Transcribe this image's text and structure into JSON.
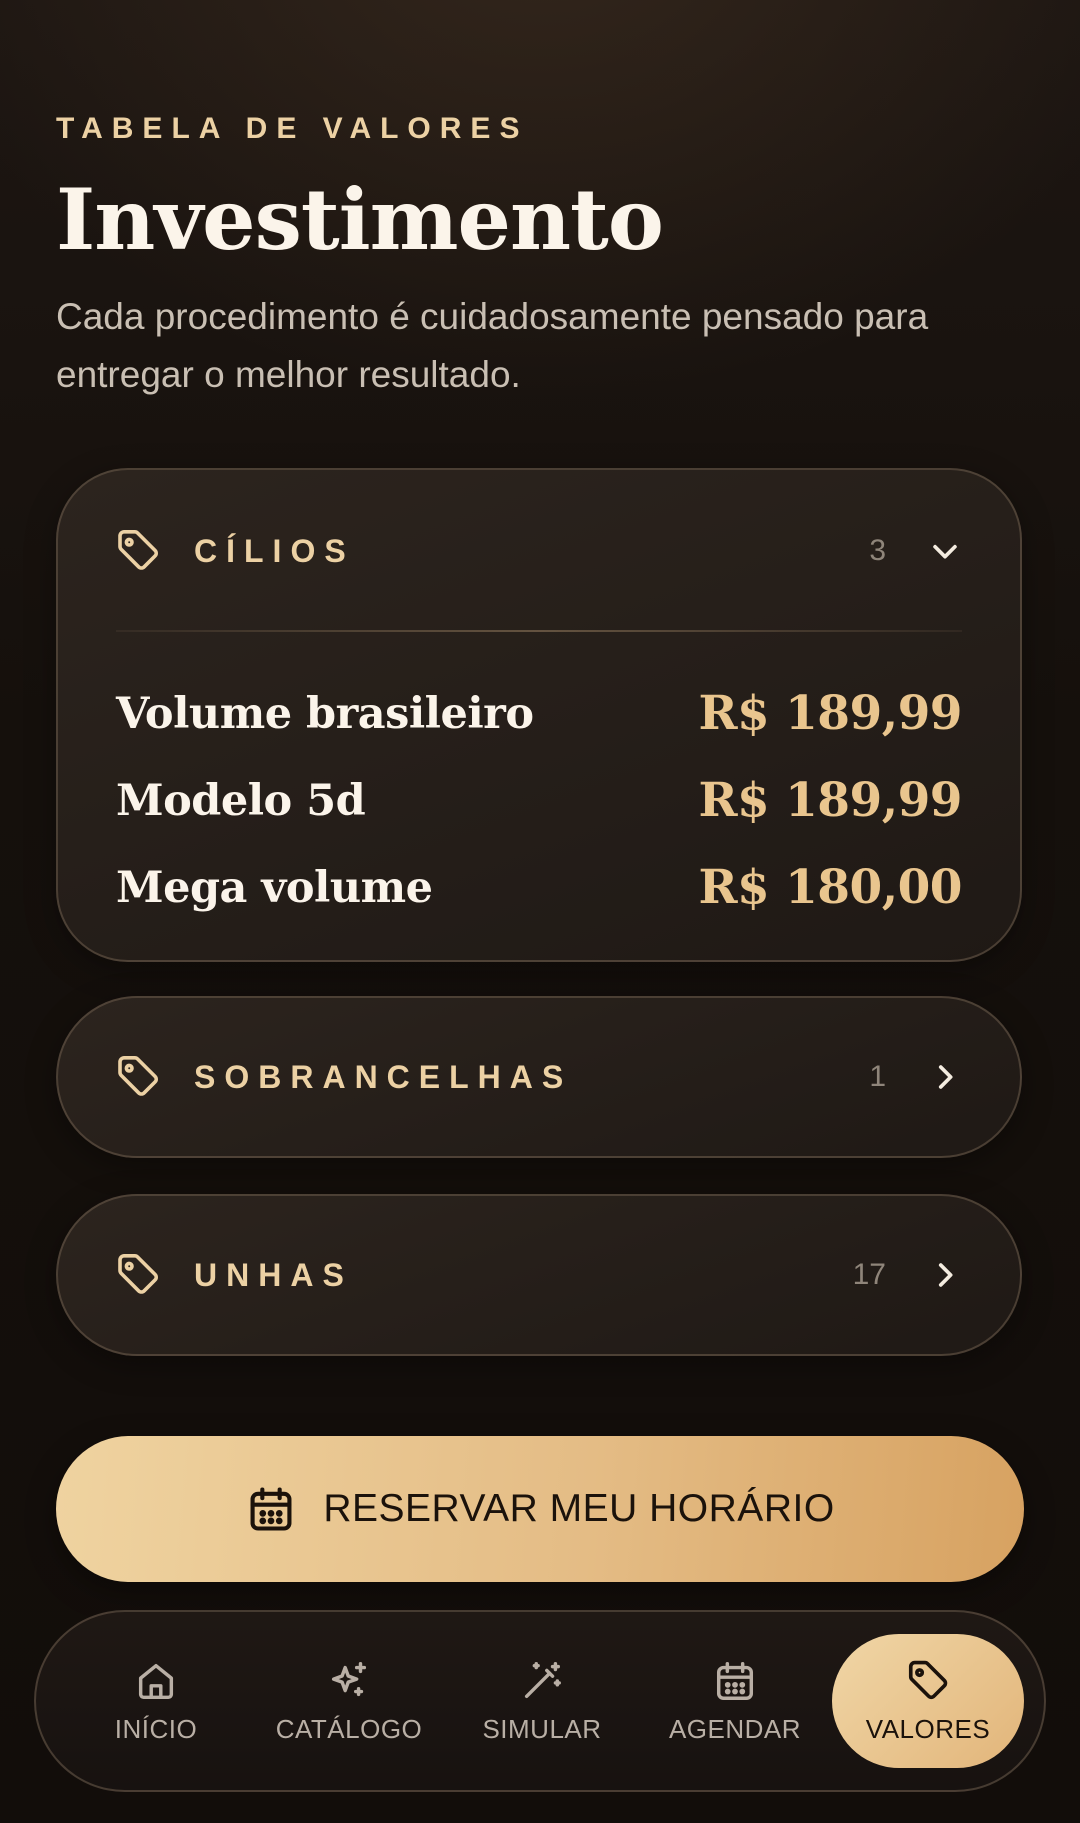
{
  "header": {
    "eyebrow": "TABELA DE VALORES",
    "title": "Investimento",
    "subtitle": "Cada procedimento é cuidadosamente pensado para entregar o melhor resultado."
  },
  "categories": [
    {
      "label": "CÍLIOS",
      "count": "3",
      "expanded": true,
      "icon": "tag-icon",
      "items": [
        {
          "name": "Volume brasileiro",
          "price": "R$ 189,99"
        },
        {
          "name": "Modelo 5d",
          "price": "R$ 189,99"
        },
        {
          "name": "Mega volume",
          "price": "R$ 180,00"
        }
      ]
    },
    {
      "label": "SOBRANCELHAS",
      "count": "1",
      "expanded": false,
      "icon": "tag-icon"
    },
    {
      "label": "UNHAS",
      "count": "17",
      "expanded": false,
      "icon": "tag-icon"
    }
  ],
  "cta": {
    "label": "RESERVAR MEU HORÁRIO",
    "icon": "calendar-icon"
  },
  "nav": [
    {
      "label": "INÍCIO",
      "icon": "home-icon",
      "active": false
    },
    {
      "label": "CATÁLOGO",
      "icon": "sparkles-icon",
      "active": false
    },
    {
      "label": "SIMULAR",
      "icon": "magic-wand-icon",
      "active": false
    },
    {
      "label": "AGENDAR",
      "icon": "calendar-icon",
      "active": false
    },
    {
      "label": "VALORES",
      "icon": "tag-icon",
      "active": true
    }
  ],
  "colors": {
    "accent": "#e9c58e",
    "background": "#15100c",
    "card": "#2a221c",
    "text": "#fbf4ea",
    "muted": "#c9bfb3"
  }
}
